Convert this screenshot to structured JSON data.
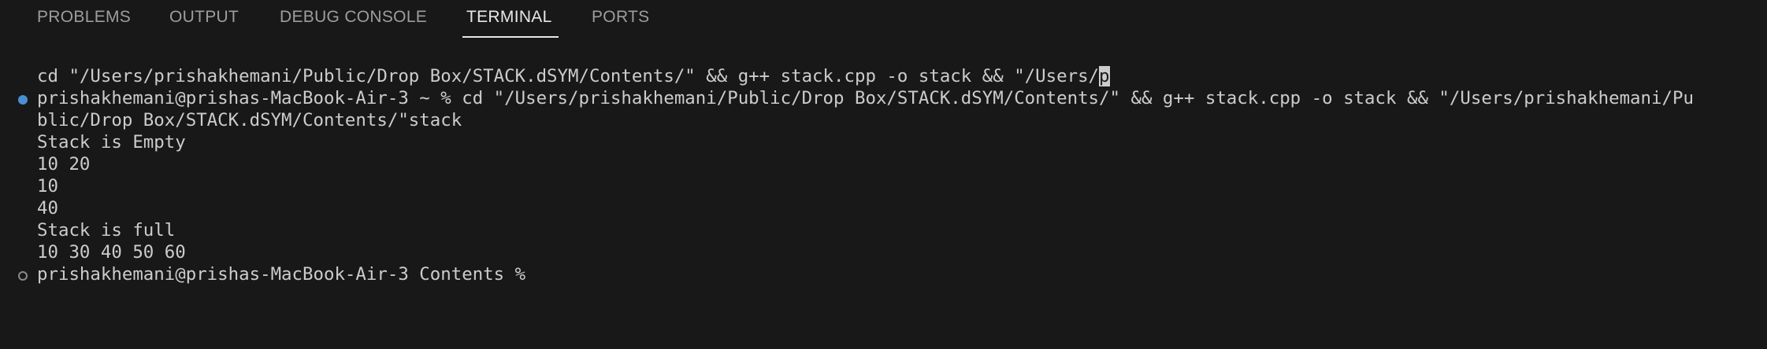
{
  "tabs": [
    {
      "label": "PROBLEMS"
    },
    {
      "label": "OUTPUT"
    },
    {
      "label": "DEBUG CONSOLE"
    },
    {
      "label": "TERMINAL"
    },
    {
      "label": "PORTS"
    }
  ],
  "active_tab": "TERMINAL",
  "terminal": {
    "lines": [
      {
        "text": "cd \"/Users/prishakhemani/Public/Drop Box/STACK.dSYM/Contents/\" && g++ stack.cpp -o stack && \"/Users/"
      },
      {
        "text": "prishakhemani@prishas-MacBook-Air-3 ~ % cd \"/Users/prishakhemani/Public/Drop Box/STACK.dSYM/Contents/\" && g++ stack.cpp -o stack && \"/Users/prishakhemani/Pu"
      },
      {
        "text": "blic/Drop Box/STACK.dSYM/Contents/\"stack"
      },
      {
        "text": "Stack is Empty"
      },
      {
        "text": "10 20"
      },
      {
        "text": "10"
      },
      {
        "text": "40"
      },
      {
        "text": "Stack is full"
      },
      {
        "text": "10 30 40 50 60"
      },
      {
        "text": "prishakhemani@prishas-MacBook-Air-3 Contents % "
      }
    ],
    "cursor_char": "p",
    "colors": {
      "background": "#181818",
      "foreground": "#cccccc",
      "success_dot": "#4a8fd4",
      "idle_dot": "#8a8a8a"
    }
  }
}
